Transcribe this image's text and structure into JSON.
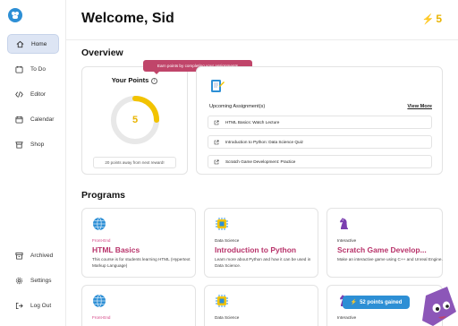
{
  "user": {
    "welcome": "Welcome, Sid",
    "points": "5"
  },
  "sidebar": {
    "items": [
      {
        "label": "Home",
        "icon": "home-icon",
        "active": true
      },
      {
        "label": "To Do",
        "icon": "todo-icon"
      },
      {
        "label": "Editor",
        "icon": "code-icon"
      },
      {
        "label": "Calendar",
        "icon": "calendar-icon"
      },
      {
        "label": "Shop",
        "icon": "shop-icon"
      }
    ],
    "bottom": [
      {
        "label": "Archived",
        "icon": "archive-icon"
      },
      {
        "label": "Settings",
        "icon": "gear-icon"
      },
      {
        "label": "Log Out",
        "icon": "logout-icon"
      }
    ]
  },
  "overview": {
    "title": "Overview",
    "points_card": {
      "title": "Your Points",
      "value": "5",
      "progress": 0.25,
      "away_text": "20 points away from next reward!"
    },
    "tooltip": "Earn points by completing your assignments",
    "assignments": {
      "heading": "Upcoming Assignment(s)",
      "view_more": "View More",
      "items": [
        "HTML Basics: Watch Lecture",
        "Introduction to Python: Data Science Quiz",
        "Scratch Game Development: Practice"
      ]
    }
  },
  "programs": {
    "title": "Programs",
    "cards": [
      {
        "category": "Front-End",
        "name": "HTML Basics",
        "desc": "This course is for students learning HTML (Hypertext Markup Language)",
        "icon": "globe-icon"
      },
      {
        "category": "Data Science",
        "name": "Introduction to Python",
        "desc": "Learn more about Python and how it can be used in Data Science.",
        "icon": "chip-icon"
      },
      {
        "category": "Interactive",
        "name": "Scratch Game Develop...",
        "desc": "Make an interactive game using C++ and Unreal Engine.",
        "icon": "chess-knight-icon"
      },
      {
        "category": "Front-End",
        "name": "",
        "desc": "",
        "icon": "globe-icon"
      },
      {
        "category": "Data Science",
        "name": "",
        "desc": "",
        "icon": "chip-icon"
      },
      {
        "category": "Interactive",
        "name": "",
        "desc": "",
        "icon": "chess-knight-icon"
      }
    ]
  },
  "toast": "52 points gained",
  "colors": {
    "accent": "#2d8fd5",
    "points": "#e9b400",
    "pink": "#c0456a",
    "active_nav": "#dde5f4"
  }
}
